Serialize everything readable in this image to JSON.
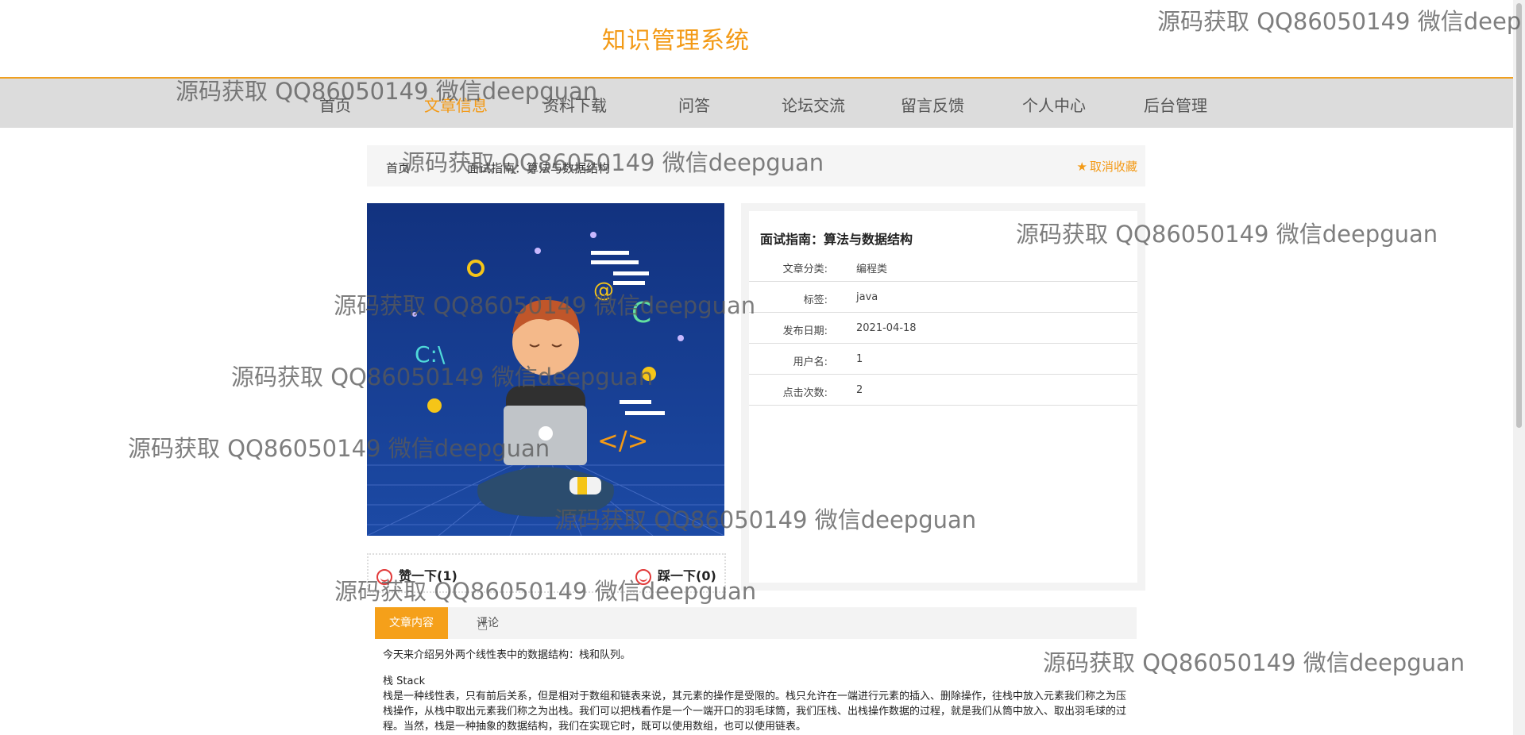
{
  "app": {
    "title": "知识管理系统"
  },
  "nav": [
    {
      "label": "首页",
      "active": false
    },
    {
      "label": "文章信息",
      "active": true
    },
    {
      "label": "资料下载",
      "active": false
    },
    {
      "label": "问答",
      "active": false
    },
    {
      "label": "论坛交流",
      "active": false
    },
    {
      "label": "留言反馈",
      "active": false
    },
    {
      "label": "个人中心",
      "active": false
    },
    {
      "label": "后台管理",
      "active": false
    }
  ],
  "breadcrumb": {
    "home": "首页",
    "current": "面试指南：算法与数据结构"
  },
  "favorite": {
    "label": "取消收藏",
    "icon": "star-icon"
  },
  "article": {
    "title": "面试指南：算法与数据结构",
    "rows": [
      {
        "label": "文章分类:",
        "value": "编程类"
      },
      {
        "label": "标签:",
        "value": "java"
      },
      {
        "label": "发布日期:",
        "value": "2021-04-18"
      },
      {
        "label": "用户名:",
        "value": "1"
      },
      {
        "label": "点击次数:",
        "value": "2"
      }
    ]
  },
  "votes": {
    "like": "赞一下(1)",
    "dislike": "踩一下(0)"
  },
  "tabs": [
    {
      "label": "文章内容",
      "active": true
    },
    {
      "label": "评论",
      "active": false
    }
  ],
  "content": {
    "intro": "今天来介绍另外两个线性表中的数据结构：栈和队列。",
    "heading": "栈 Stack",
    "body": "栈是一种线性表，只有前后关系，但是相对于数组和链表来说，其元素的操作是受限的。栈只允许在一端进行元素的插入、删除操作，往栈中放入元素我们称之为压栈操作，从栈中取出元素我们称之为出栈。我们可以把栈看作是一个一端开口的羽毛球筒，我们压栈、出栈操作数据的过程，就是我们从筒中放入、取出羽毛球的过程。当然，栈是一种抽象的数据结构，我们在实现它时，既可以使用数组，也可以使用链表。"
  },
  "watermark": {
    "text": "源码获取 QQ86050149 微信deepguan",
    "text_clipped": "源码获取 QQ86050149 微信deep"
  },
  "colors": {
    "accent": "#f39a16",
    "nav_bg": "#dcdcdc",
    "cover_bg": "#1d3d8f"
  }
}
